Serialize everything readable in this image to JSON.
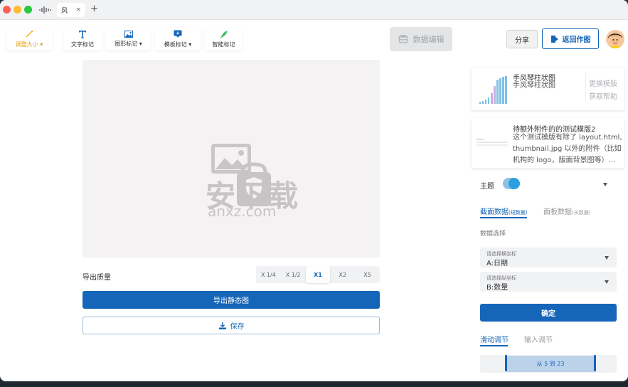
{
  "window": {
    "tab_label": "风",
    "tab_close": "×",
    "new_tab": "+"
  },
  "toolbar": {
    "resize": "调整大小",
    "text_mark": "文字标记",
    "shape_mark": "图形标记",
    "template_mark": "模板标记",
    "smart_mark": "智能标记",
    "data_edit": "数据编辑",
    "share": "分享",
    "back": "返回作图"
  },
  "export": {
    "quality_label": "导出质量",
    "options": [
      "X 1/4",
      "X 1/2",
      "X1",
      "X2",
      "X5"
    ],
    "selected": "X1",
    "export_button": "导出静态图",
    "save_button": "保存"
  },
  "watermark": {
    "main": "安下载",
    "sub": "anxz.com"
  },
  "templates": [
    {
      "title": "手风琴柱状图",
      "subtitle": "手风琴柱状图",
      "action_change": "更换模版",
      "action_help": "获取帮助"
    },
    {
      "title": "待额外附件的的测试模版2",
      "desc_line1": "这个测试模版有除了 layout.html,",
      "desc_line2": "thumbnail.jpg 以外的附件（比如",
      "desc_line3": "机构的 logo，版面背景图等）..."
    }
  ],
  "panel": {
    "theme_label": "主题",
    "tab_active": "截面数据",
    "tab_active_note": "(短数据)",
    "tab_inactive": "面板数据",
    "tab_inactive_note": "(长数据)",
    "data_select_label": "数据选择",
    "x_select_hint": "请选择横坐标",
    "x_select_value": "A:日期",
    "y_select_hint": "请选择纵坐标",
    "y_select_value": "B:数量",
    "confirm": "确定",
    "slide_tab": "滑动调节",
    "input_tab": "输入调节",
    "range_text": "从 5 到 23"
  },
  "colors": {
    "primary": "#1565b8",
    "accent_yellow": "#f0b429",
    "toggle": "#29a0dd"
  }
}
